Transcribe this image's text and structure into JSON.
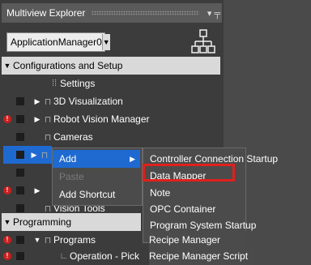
{
  "panel": {
    "title": "Multiview Explorer",
    "pin_glyph": "▾ ꟷ"
  },
  "app_selector": {
    "value": "ApplicationManager0"
  },
  "tree": {
    "config_section": "Configurations and Setup",
    "items": [
      {
        "label": "Settings"
      },
      {
        "label": "3D Visualization"
      },
      {
        "label": "Robot Vision Manager"
      },
      {
        "label": "Cameras"
      },
      {
        "label": "Vision Tools"
      }
    ],
    "programming_section": "Programming",
    "programs": "Programs",
    "operation": "Operation - Pick"
  },
  "context_menu": {
    "items": [
      {
        "label": "Add"
      },
      {
        "label": "Paste"
      },
      {
        "label": "Add Shortcut"
      }
    ]
  },
  "submenu": {
    "items": [
      {
        "label": "Controller Connection Startup"
      },
      {
        "label": "Data Mapper"
      },
      {
        "label": "Note"
      },
      {
        "label": "OPC Container"
      },
      {
        "label": "Program System Startup"
      },
      {
        "label": "Recipe Manager"
      },
      {
        "label": "Recipe Manager Script"
      }
    ]
  },
  "colors": {
    "highlight": "#1f6ad1",
    "annotation": "#e0201c",
    "error": "#cc1f1f"
  },
  "icons": [
    "hierarchy-icon",
    "dropdown-arrow-icon",
    "pin-icon",
    "error-icon",
    "folder-icon"
  ]
}
